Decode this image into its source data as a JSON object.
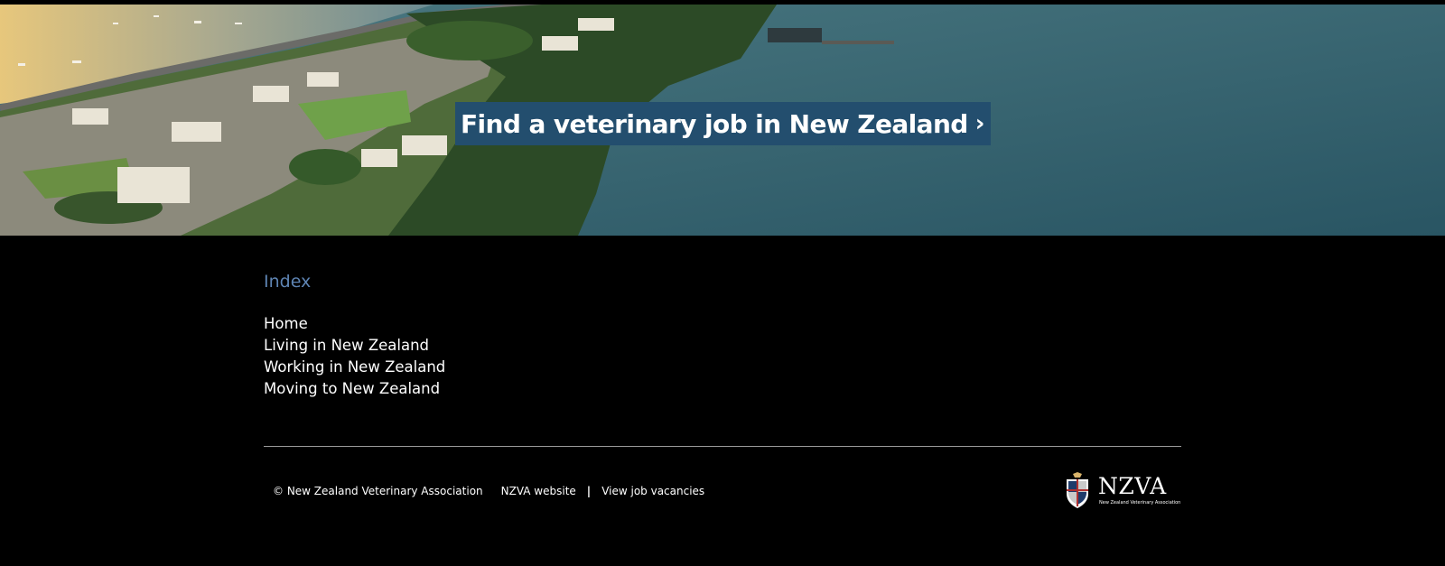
{
  "hero": {
    "cta_label": "Find a veterinary job in New Zealand",
    "cta_chevron": "›"
  },
  "footer": {
    "index_title": "Index",
    "links": [
      "Home",
      "Living in New Zealand",
      "Working in New Zealand",
      "Moving to New Zealand"
    ],
    "copyright": "© New Zealand Veterinary Association",
    "nzva_website": "NZVA website",
    "separator": "|",
    "job_vacancies": "View job vacancies",
    "logo_text": "NZVA",
    "logo_subtext": "New Zealand Veterinary Association"
  },
  "colors": {
    "cta_background": "#234e6e",
    "index_title": "#5e84b3",
    "footer_background": "#000000"
  }
}
